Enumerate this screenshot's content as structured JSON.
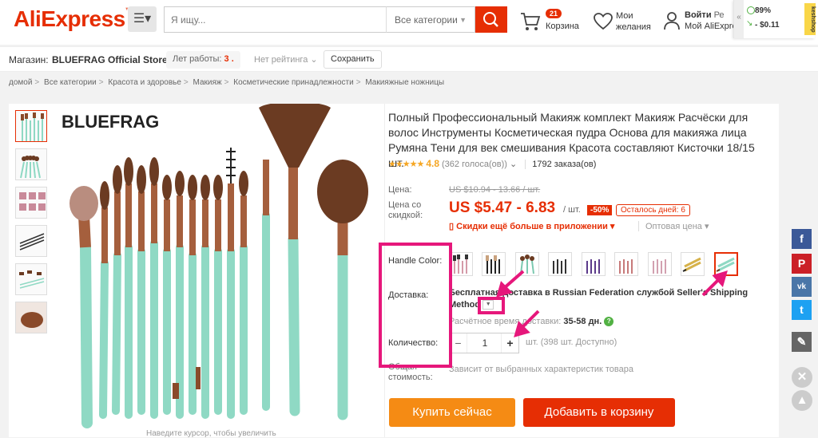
{
  "header": {
    "logo_text": "AliExpress",
    "search_placeholder": "Я ищу...",
    "category": "Все категории",
    "cart_count": "21",
    "cart_label": "Корзина",
    "wishlist_line1": "Мои",
    "wishlist_line2": "желания",
    "signin": "Войти",
    "register": "Ре",
    "account": "Мой AliExpress",
    "widget_percent": "89%",
    "widget_delta": "- $0.11",
    "widget_badge": "keshshop"
  },
  "store": {
    "label": "Магазин:",
    "name": "BLUEFRAG Official Store",
    "years_label": "Лет работы:",
    "years_value": "3 .",
    "rating": "Нет рейтинга",
    "save": "Сохранить"
  },
  "breadcrumb": [
    "домой",
    "Все категории",
    "Красота и здоровье",
    "Макияж",
    "Косметические принадлежности",
    "Макияжные ножницы"
  ],
  "product": {
    "brand": "BLUEFRAG",
    "title": "Полный Профессиональный Макияж комплект Макияж Расчёски для волос Инструменты Косметическая пудра Основа для макияжа лица Румяна Тени для век смешивания Красота составляют Кисточки 18/15 шт.",
    "rating": "4.8",
    "votes": "(362 голоса(ов))",
    "orders": "1792 заказа(ов)",
    "price_label": "Цена:",
    "old_price": "US $10.94 - 13.66 / шт.",
    "sale_label": "Цена со скидкой:",
    "sale_price": "US $5.47 - 6.83",
    "per_unit": "/ шт.",
    "discount": "-50%",
    "days_left": "Осталось дней: 6",
    "app_discount": "Скидки ещё больше в приложении",
    "wholesale": "Оптовая цена",
    "image_hint": "Наведите курсор, чтобы увеличить"
  },
  "options": {
    "color_label": "Handle Color:",
    "shipping_label": "Доставка:",
    "shipping_text_1": "Бесплатная доставка в Russian Federation службой Seller's Shipping",
    "shipping_text_2": "Method",
    "delivery_time_label": "Расчётное время доставки:",
    "delivery_time": "35-58 дн.",
    "qty_label": "Количество:",
    "qty_value": "1",
    "qty_note": "шт. (398 шт. Доступно)",
    "total_label_1": "Общая",
    "total_label_2": "стоимость:",
    "total_value": "Зависит от выбранных характеристик товара"
  },
  "actions": {
    "buy_now": "Купить сейчас",
    "add_to_cart": "Добавить в корзину"
  },
  "colors": {
    "brand": "#e62e04",
    "buy": "#f58b14",
    "highlight": "#e6177b",
    "mint": "#8fd9c4"
  }
}
